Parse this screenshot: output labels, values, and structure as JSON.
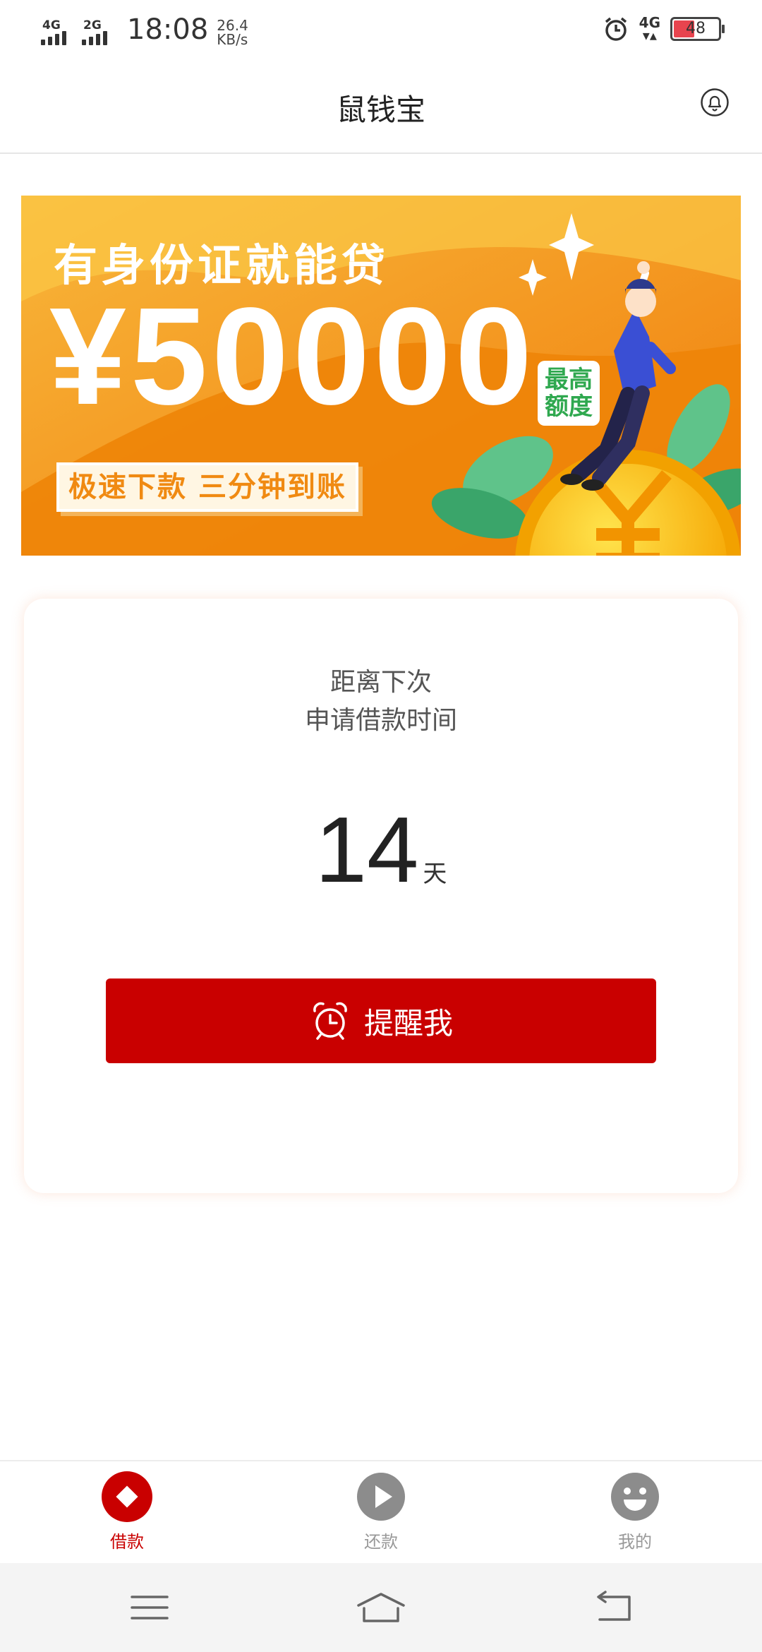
{
  "status_bar": {
    "network1": "4G",
    "network2": "2G",
    "time": "18:08",
    "speed_value": "26.4",
    "speed_unit": "KB/s",
    "data_network": "4G",
    "battery": "48",
    "battery_level": 0.48,
    "battery_color": "#e8444e"
  },
  "header": {
    "title": "鼠钱宝",
    "bell_icon": "bell-icon"
  },
  "banner": {
    "tagline": "有身份证就能贷",
    "amount": "¥50000",
    "badge_line1": "最高",
    "badge_line2": "额度",
    "slogan": "极速下款  三分钟到账"
  },
  "card": {
    "label_line1": "距离下次",
    "label_line2": "申请借款时间",
    "days": "14",
    "days_unit": "天",
    "button_label": "提醒我",
    "button_icon": "alarm-clock-icon"
  },
  "tabs": [
    {
      "label": "借款",
      "icon": "loan-diamond-icon",
      "active": true
    },
    {
      "label": "还款",
      "icon": "play-icon",
      "active": false
    },
    {
      "label": "我的",
      "icon": "smiley-icon",
      "active": false
    }
  ],
  "colors": {
    "accent": "#c90000",
    "banner_orange": "#f29a1f",
    "inactive_tab": "#999999"
  },
  "system_nav": [
    "menu-icon",
    "home-icon",
    "back-icon"
  ]
}
